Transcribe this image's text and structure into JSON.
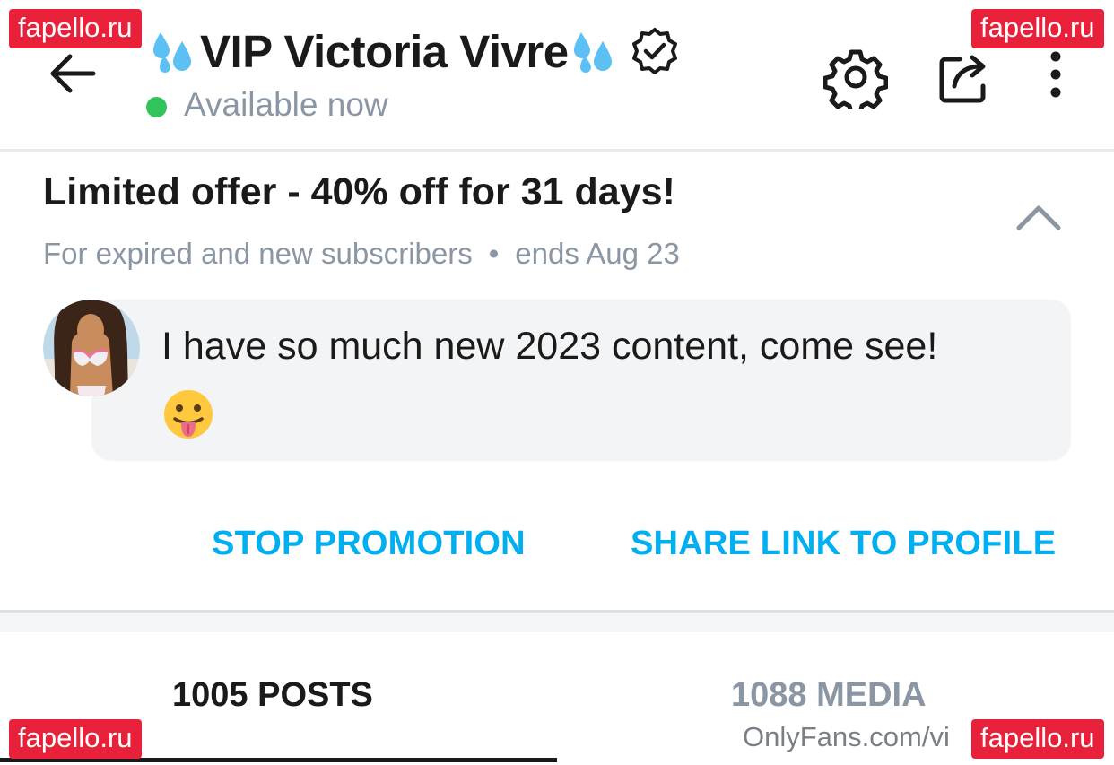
{
  "header": {
    "title": "VIP Victoria Vivre",
    "status": "Available now",
    "icons": {
      "back": "arrow-left-icon",
      "settings": "gear-icon",
      "share": "share-icon",
      "more": "more-vertical-icon",
      "verified": "verified-badge-icon",
      "decoration": "sweat-droplets-emoji"
    }
  },
  "offer": {
    "title": "Limited offer - 40% off for 31 days!",
    "audience": "For expired and new subscribers",
    "separator": "•",
    "ends": "ends Aug 23",
    "message": "I have so much new 2023 content, come see!",
    "emoji": "😛",
    "stop_label": "STOP PROMOTION",
    "share_label": "SHARE LINK TO PROFILE"
  },
  "tabs": {
    "posts": "1005 POSTS",
    "media": "1088 MEDIA"
  },
  "source_url": "OnlyFans.com/vi",
  "watermark": "fapello.ru",
  "colors": {
    "accent": "#00aff0",
    "status_online": "#30c45b",
    "muted_text": "#8a96a3",
    "watermark_bg": "#e8203a",
    "message_bg": "#f3f4f6"
  }
}
